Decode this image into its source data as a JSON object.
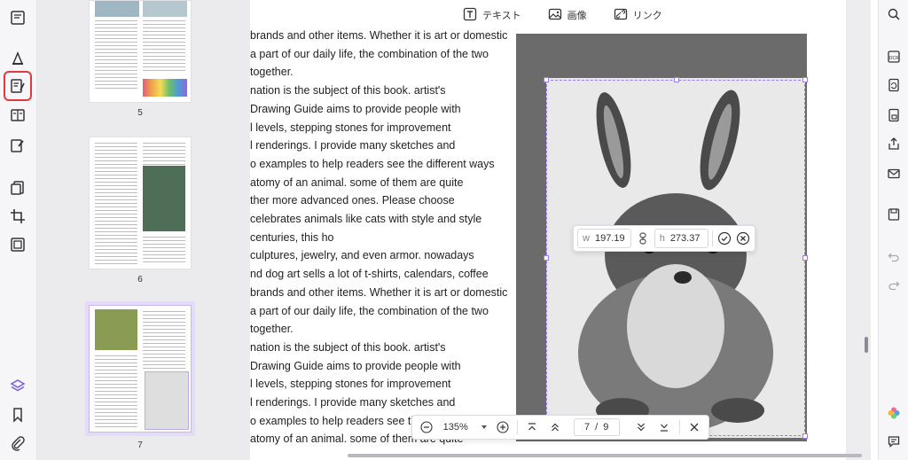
{
  "toolbar": {
    "text_label": "テキスト",
    "image_label": "画像",
    "link_label": "リンク"
  },
  "thumbnails": [
    {
      "page": "5"
    },
    {
      "page": "6"
    },
    {
      "page": "7"
    }
  ],
  "document_lines": [
    "brands and other items. Whether it is art or domestic",
    " a part of our daily life, the combination of the two",
    "together.",
    "nation is the subject of this book. artist's",
    "Drawing Guide aims to provide people with",
    "l levels, stepping stones for improvement",
    "l renderings. I provide many sketches and",
    "o examples to help readers see the different ways",
    "atomy of an animal. some of them are quite",
    "ther more advanced ones. Please choose",
    " celebrates animals like cats with style and style",
    "centuries, this ho",
    "culptures, jewelry, and even armor. nowadays",
    "nd dog art sells a lot of t-shirts, calendars, coffee",
    "brands and other items. Whether it is art or domestic",
    " a part of our daily life, the combination of the two",
    "together.",
    "nation is the subject of this book. artist's",
    "Drawing Guide aims to provide people with",
    "l levels, stepping stones for improvement",
    "l renderings. I provide many sketches and",
    "o examples to help readers see the different ways",
    "atomy of an animal. some of them are quite"
  ],
  "size_popup": {
    "w_label": "w",
    "w_value": "197.19",
    "h_label": "h",
    "h_value": "273.37"
  },
  "nav": {
    "zoom": "135%",
    "current_page": "7",
    "separator": "/",
    "total_pages": "9"
  },
  "colors": {
    "accent": "#9b7cf0",
    "active_outline": "#e0393e"
  }
}
